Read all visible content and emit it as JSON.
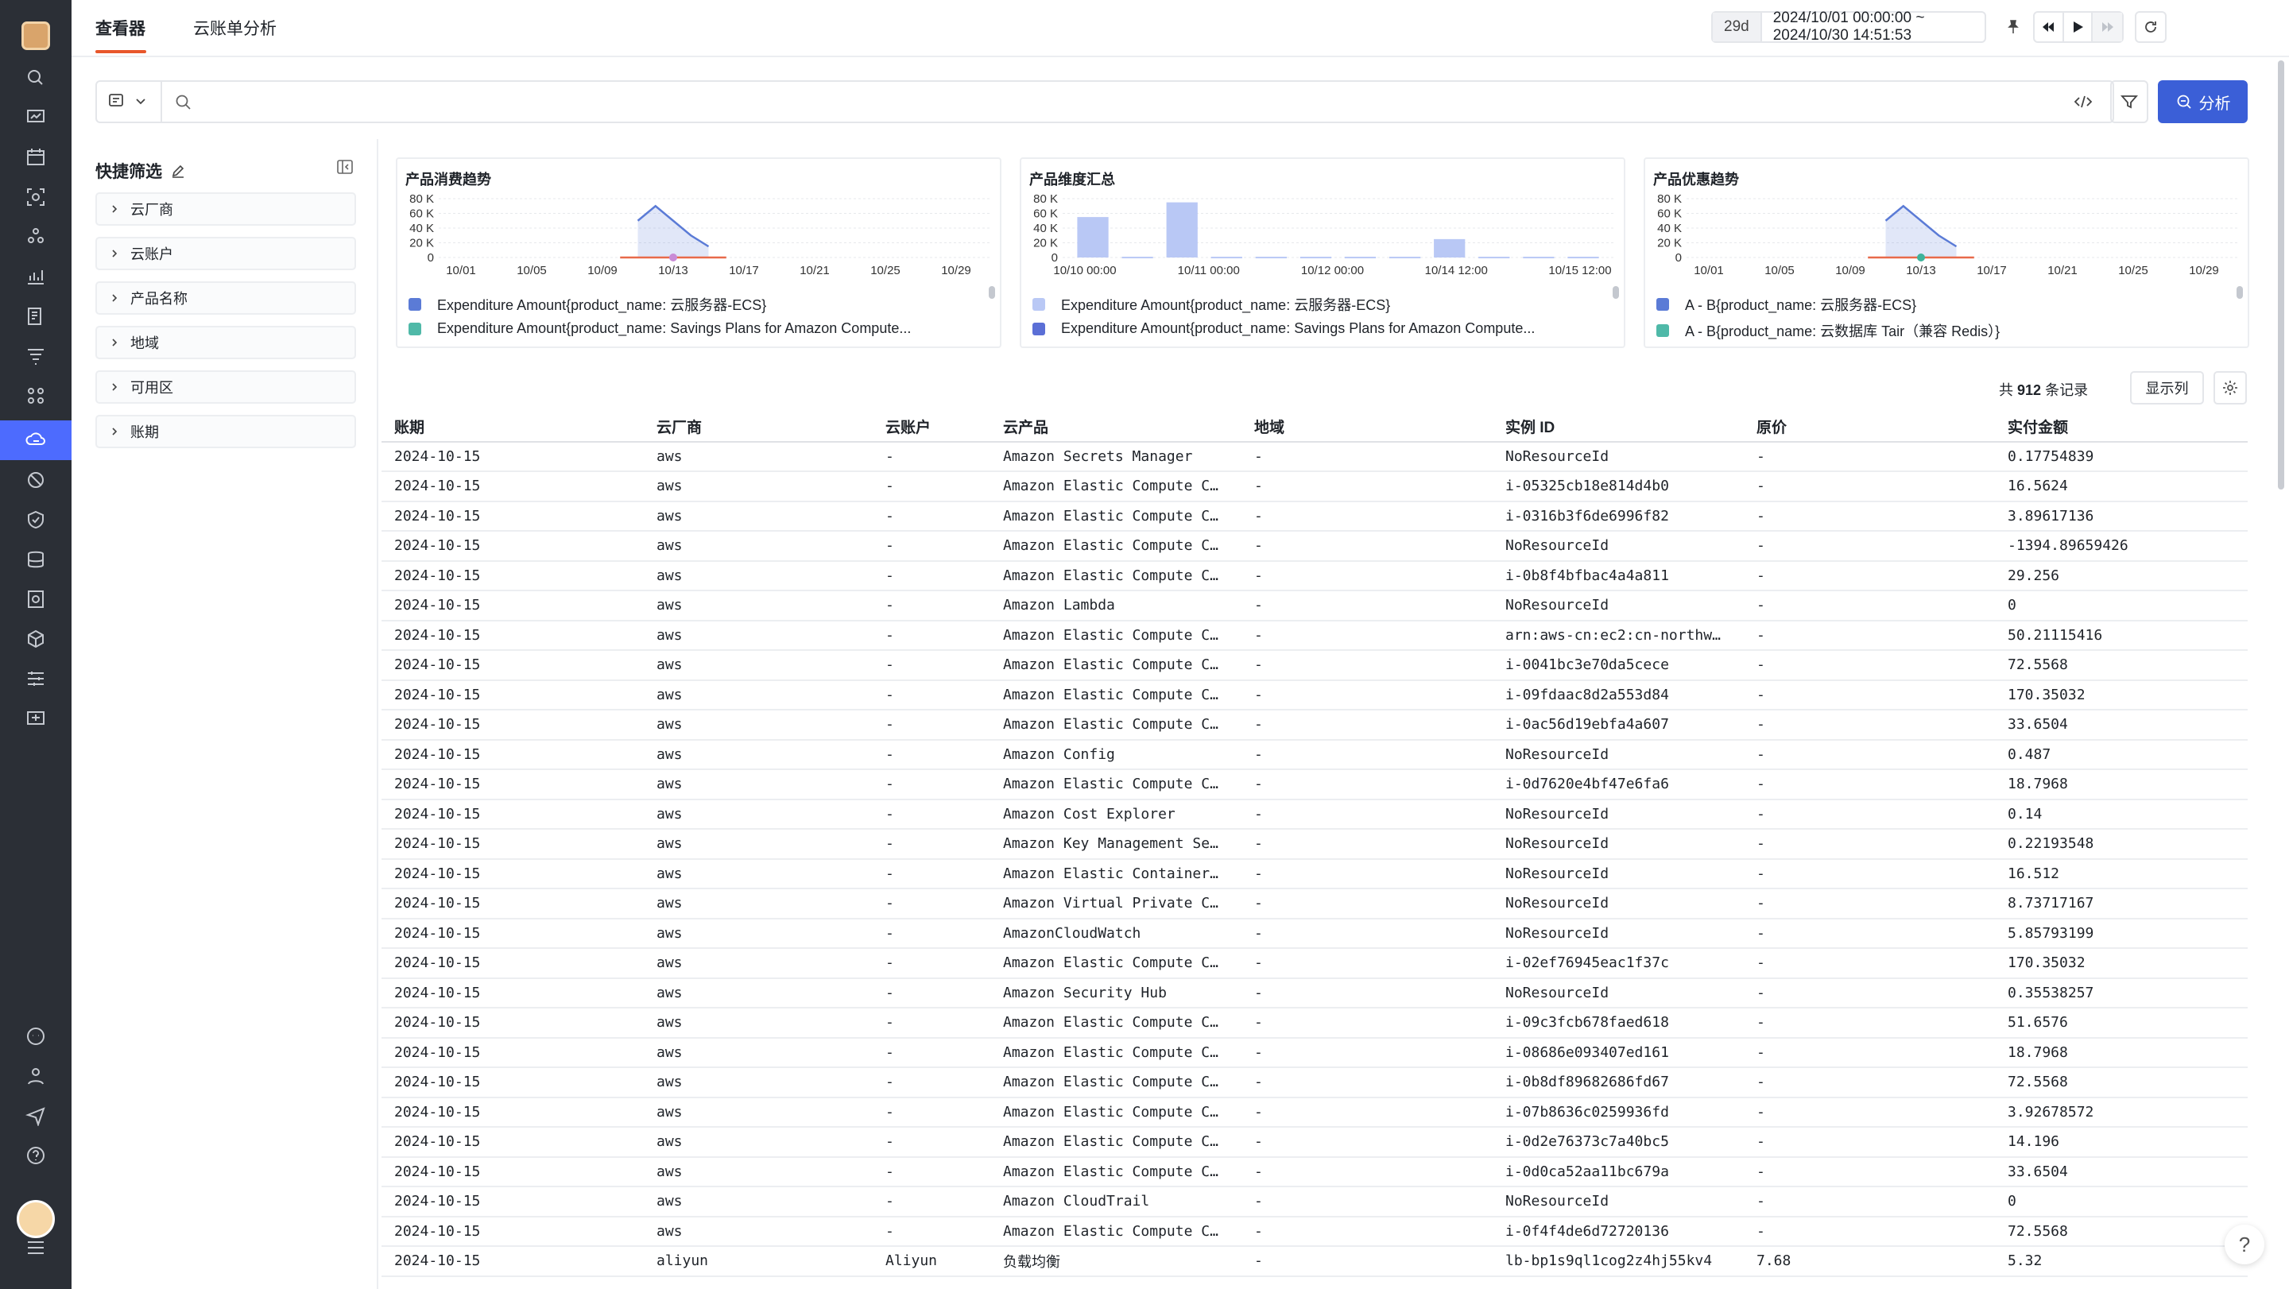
{
  "tabs": [
    {
      "label": "查看器"
    },
    {
      "label": "云账单分析"
    }
  ],
  "time": {
    "range_short": "29d",
    "range": "2024/10/01 00:00:00 ~ 2024/10/30 14:51:53"
  },
  "analyze_button": "分析",
  "quick_filter": {
    "title": "快捷筛选",
    "items": [
      "云厂商",
      "云账户",
      "产品名称",
      "地域",
      "可用区",
      "账期"
    ]
  },
  "charts": [
    {
      "title": "产品消费趋势",
      "y_ticks": [
        "80 K",
        "60 K",
        "40 K",
        "20 K",
        "0"
      ],
      "x_ticks": [
        "10/01",
        "10/05",
        "10/09",
        "10/13",
        "10/17",
        "10/21",
        "10/25",
        "10/29"
      ],
      "legend": [
        "Expenditure Amount{product_name: 云服务器-ECS}",
        "Expenditure Amount{product_name: Savings Plans for Amazon Compute..."
      ],
      "legend_colors": [
        "#5b7bd6",
        "#4fb9a8"
      ]
    },
    {
      "title": "产品维度汇总",
      "y_ticks": [
        "80 K",
        "60 K",
        "40 K",
        "20 K",
        "0"
      ],
      "x_ticks": [
        "10/10 00:00",
        "10/11 00:00",
        "10/12 00:00",
        "10/14 12:00",
        "10/15 12:00"
      ],
      "legend": [
        "Expenditure Amount{product_name: 云服务器-ECS}",
        "Expenditure Amount{product_name: Savings Plans for Amazon Compute..."
      ],
      "legend_colors": [
        "#b9c8f5",
        "#5b6fd6"
      ]
    },
    {
      "title": "产品优惠趋势",
      "y_ticks": [
        "80 K",
        "60 K",
        "40 K",
        "20 K",
        "0"
      ],
      "x_ticks": [
        "10/01",
        "10/05",
        "10/09",
        "10/13",
        "10/17",
        "10/21",
        "10/25",
        "10/29"
      ],
      "legend": [
        "A - B{product_name: 云服务器-ECS}",
        "A - B{product_name: 云数据库 Tair（兼容 Redis）}"
      ],
      "legend_colors": [
        "#5b7bd6",
        "#4fb9a8"
      ]
    }
  ],
  "chart_data": [
    {
      "type": "line",
      "title": "产品消费趋势",
      "x": [
        "10/10",
        "10/11",
        "10/12",
        "10/13",
        "10/14",
        "10/15",
        "10/16"
      ],
      "series": [
        {
          "name": "Expenditure Amount{product_name: 云服务器-ECS}",
          "values": [
            null,
            50000,
            70000,
            50000,
            30000,
            15000,
            null
          ]
        },
        {
          "name": "Expenditure Amount{product_name: Savings Plans for Amazon Compute...",
          "values": [
            0,
            0,
            0,
            0,
            0,
            0,
            0
          ]
        }
      ],
      "ylim": [
        0,
        80000
      ]
    },
    {
      "type": "bar",
      "title": "产品维度汇总",
      "categories": [
        "10/10 00:00",
        "10/10 12:00",
        "10/11 00:00",
        "10/11 12:00",
        "10/12 00:00",
        "10/12 12:00",
        "10/13 00:00",
        "10/13 12:00",
        "10/14 12:00",
        "10/15 00:00",
        "10/15 12:00",
        "10/16 00:00"
      ],
      "values": [
        55000,
        1000,
        75000,
        1000,
        1000,
        1000,
        1000,
        1000,
        25000,
        1000,
        1000,
        1000
      ],
      "ylim": [
        0,
        80000
      ]
    },
    {
      "type": "line",
      "title": "产品优惠趋势",
      "x": [
        "10/10",
        "10/11",
        "10/12",
        "10/13",
        "10/14",
        "10/15",
        "10/16"
      ],
      "series": [
        {
          "name": "A - B{product_name: 云服务器-ECS}",
          "values": [
            null,
            50000,
            70000,
            50000,
            30000,
            15000,
            null
          ]
        },
        {
          "name": "A - B{product_name: 云数据库 Tair（兼容 Redis）}",
          "values": [
            0,
            0,
            0,
            0,
            0,
            0,
            0
          ]
        }
      ],
      "ylim": [
        0,
        80000
      ]
    }
  ],
  "table": {
    "record_prefix": "共",
    "record_count": "912",
    "record_suffix": "条记录",
    "columns_button": "显示列",
    "headers": [
      "账期",
      "云厂商",
      "云账户",
      "云产品",
      "地域",
      "实例 ID",
      "原价",
      "实付金额"
    ],
    "rows": [
      [
        "2024-10-15",
        "aws",
        "-",
        "Amazon Secrets Manager",
        "-",
        "NoResourceId",
        "-",
        "0.17754839"
      ],
      [
        "2024-10-15",
        "aws",
        "-",
        "Amazon Elastic Compute C…",
        "-",
        "i-05325cb18e814d4b0",
        "-",
        "16.5624"
      ],
      [
        "2024-10-15",
        "aws",
        "-",
        "Amazon Elastic Compute C…",
        "-",
        "i-0316b3f6de6996f82",
        "-",
        "3.89617136"
      ],
      [
        "2024-10-15",
        "aws",
        "-",
        "Amazon Elastic Compute C…",
        "-",
        "NoResourceId",
        "-",
        "-1394.89659426"
      ],
      [
        "2024-10-15",
        "aws",
        "-",
        "Amazon Elastic Compute C…",
        "-",
        "i-0b8f4bfbac4a4a811",
        "-",
        "29.256"
      ],
      [
        "2024-10-15",
        "aws",
        "-",
        "Amazon Lambda",
        "-",
        "NoResourceId",
        "-",
        "0"
      ],
      [
        "2024-10-15",
        "aws",
        "-",
        "Amazon Elastic Compute C…",
        "-",
        "arn:aws-cn:ec2:cn-northw…",
        "-",
        "50.21115416"
      ],
      [
        "2024-10-15",
        "aws",
        "-",
        "Amazon Elastic Compute C…",
        "-",
        "i-0041bc3e70da5cece",
        "-",
        "72.5568"
      ],
      [
        "2024-10-15",
        "aws",
        "-",
        "Amazon Elastic Compute C…",
        "-",
        "i-09fdaac8d2a553d84",
        "-",
        "170.35032"
      ],
      [
        "2024-10-15",
        "aws",
        "-",
        "Amazon Elastic Compute C…",
        "-",
        "i-0ac56d19ebfa4a607",
        "-",
        "33.6504"
      ],
      [
        "2024-10-15",
        "aws",
        "-",
        "Amazon Config",
        "-",
        "NoResourceId",
        "-",
        "0.487"
      ],
      [
        "2024-10-15",
        "aws",
        "-",
        "Amazon Elastic Compute C…",
        "-",
        "i-0d7620e4bf47e6fa6",
        "-",
        "18.7968"
      ],
      [
        "2024-10-15",
        "aws",
        "-",
        "Amazon Cost Explorer",
        "-",
        "NoResourceId",
        "-",
        "0.14"
      ],
      [
        "2024-10-15",
        "aws",
        "-",
        "Amazon Key Management Se…",
        "-",
        "NoResourceId",
        "-",
        "0.22193548"
      ],
      [
        "2024-10-15",
        "aws",
        "-",
        "Amazon Elastic Container…",
        "-",
        "NoResourceId",
        "-",
        "16.512"
      ],
      [
        "2024-10-15",
        "aws",
        "-",
        "Amazon Virtual Private C…",
        "-",
        "NoResourceId",
        "-",
        "8.73717167"
      ],
      [
        "2024-10-15",
        "aws",
        "-",
        "AmazonCloudWatch",
        "-",
        "NoResourceId",
        "-",
        "5.85793199"
      ],
      [
        "2024-10-15",
        "aws",
        "-",
        "Amazon Elastic Compute C…",
        "-",
        "i-02ef76945eac1f37c",
        "-",
        "170.35032"
      ],
      [
        "2024-10-15",
        "aws",
        "-",
        "Amazon Security Hub",
        "-",
        "NoResourceId",
        "-",
        "0.35538257"
      ],
      [
        "2024-10-15",
        "aws",
        "-",
        "Amazon Elastic Compute C…",
        "-",
        "i-09c3fcb678faed618",
        "-",
        "51.6576"
      ],
      [
        "2024-10-15",
        "aws",
        "-",
        "Amazon Elastic Compute C…",
        "-",
        "i-08686e093407ed161",
        "-",
        "18.7968"
      ],
      [
        "2024-10-15",
        "aws",
        "-",
        "Amazon Elastic Compute C…",
        "-",
        "i-0b8df89682686fd67",
        "-",
        "72.5568"
      ],
      [
        "2024-10-15",
        "aws",
        "-",
        "Amazon Elastic Compute C…",
        "-",
        "i-07b8636c0259936fd",
        "-",
        "3.92678572"
      ],
      [
        "2024-10-15",
        "aws",
        "-",
        "Amazon Elastic Compute C…",
        "-",
        "i-0d2e76373c7a40bc5",
        "-",
        "14.196"
      ],
      [
        "2024-10-15",
        "aws",
        "-",
        "Amazon Elastic Compute C…",
        "-",
        "i-0d0ca52aa11bc679a",
        "-",
        "33.6504"
      ],
      [
        "2024-10-15",
        "aws",
        "-",
        "Amazon CloudTrail",
        "-",
        "NoResourceId",
        "-",
        "0"
      ],
      [
        "2024-10-15",
        "aws",
        "-",
        "Amazon Elastic Compute C…",
        "-",
        "i-0f4f4de6d72720136",
        "-",
        "72.5568"
      ],
      [
        "2024-10-15",
        "aliyun",
        "Aliyun",
        "负载均衡",
        "-",
        "lb-bp1s9ql1cog2z4hj55kv4",
        "7.68",
        "5.32"
      ]
    ]
  },
  "help_label": "?"
}
